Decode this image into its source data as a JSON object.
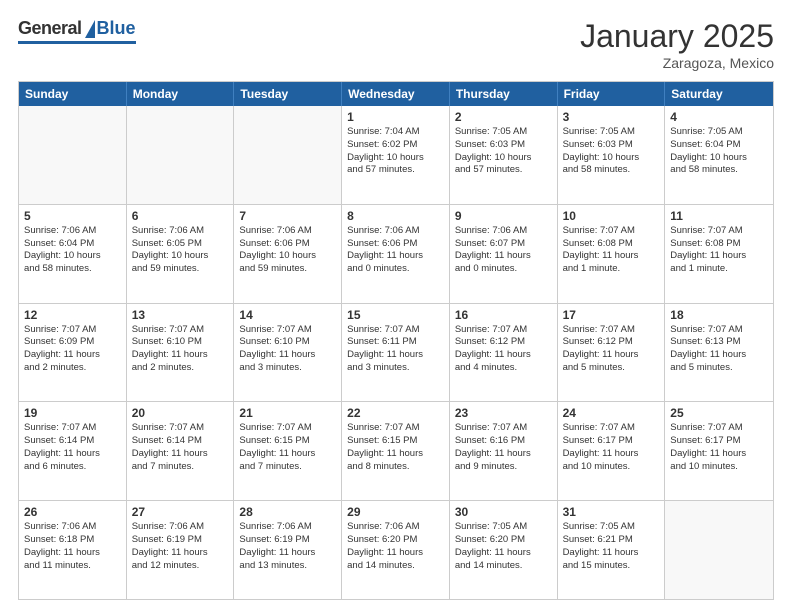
{
  "logo": {
    "general": "General",
    "blue": "Blue"
  },
  "header": {
    "month": "January 2025",
    "location": "Zaragoza, Mexico"
  },
  "days_of_week": [
    "Sunday",
    "Monday",
    "Tuesday",
    "Wednesday",
    "Thursday",
    "Friday",
    "Saturday"
  ],
  "weeks": [
    [
      {
        "day": "",
        "text": ""
      },
      {
        "day": "",
        "text": ""
      },
      {
        "day": "",
        "text": ""
      },
      {
        "day": "1",
        "text": "Sunrise: 7:04 AM\nSunset: 6:02 PM\nDaylight: 10 hours\nand 57 minutes."
      },
      {
        "day": "2",
        "text": "Sunrise: 7:05 AM\nSunset: 6:03 PM\nDaylight: 10 hours\nand 57 minutes."
      },
      {
        "day": "3",
        "text": "Sunrise: 7:05 AM\nSunset: 6:03 PM\nDaylight: 10 hours\nand 58 minutes."
      },
      {
        "day": "4",
        "text": "Sunrise: 7:05 AM\nSunset: 6:04 PM\nDaylight: 10 hours\nand 58 minutes."
      }
    ],
    [
      {
        "day": "5",
        "text": "Sunrise: 7:06 AM\nSunset: 6:04 PM\nDaylight: 10 hours\nand 58 minutes."
      },
      {
        "day": "6",
        "text": "Sunrise: 7:06 AM\nSunset: 6:05 PM\nDaylight: 10 hours\nand 59 minutes."
      },
      {
        "day": "7",
        "text": "Sunrise: 7:06 AM\nSunset: 6:06 PM\nDaylight: 10 hours\nand 59 minutes."
      },
      {
        "day": "8",
        "text": "Sunrise: 7:06 AM\nSunset: 6:06 PM\nDaylight: 11 hours\nand 0 minutes."
      },
      {
        "day": "9",
        "text": "Sunrise: 7:06 AM\nSunset: 6:07 PM\nDaylight: 11 hours\nand 0 minutes."
      },
      {
        "day": "10",
        "text": "Sunrise: 7:07 AM\nSunset: 6:08 PM\nDaylight: 11 hours\nand 1 minute."
      },
      {
        "day": "11",
        "text": "Sunrise: 7:07 AM\nSunset: 6:08 PM\nDaylight: 11 hours\nand 1 minute."
      }
    ],
    [
      {
        "day": "12",
        "text": "Sunrise: 7:07 AM\nSunset: 6:09 PM\nDaylight: 11 hours\nand 2 minutes."
      },
      {
        "day": "13",
        "text": "Sunrise: 7:07 AM\nSunset: 6:10 PM\nDaylight: 11 hours\nand 2 minutes."
      },
      {
        "day": "14",
        "text": "Sunrise: 7:07 AM\nSunset: 6:10 PM\nDaylight: 11 hours\nand 3 minutes."
      },
      {
        "day": "15",
        "text": "Sunrise: 7:07 AM\nSunset: 6:11 PM\nDaylight: 11 hours\nand 3 minutes."
      },
      {
        "day": "16",
        "text": "Sunrise: 7:07 AM\nSunset: 6:12 PM\nDaylight: 11 hours\nand 4 minutes."
      },
      {
        "day": "17",
        "text": "Sunrise: 7:07 AM\nSunset: 6:12 PM\nDaylight: 11 hours\nand 5 minutes."
      },
      {
        "day": "18",
        "text": "Sunrise: 7:07 AM\nSunset: 6:13 PM\nDaylight: 11 hours\nand 5 minutes."
      }
    ],
    [
      {
        "day": "19",
        "text": "Sunrise: 7:07 AM\nSunset: 6:14 PM\nDaylight: 11 hours\nand 6 minutes."
      },
      {
        "day": "20",
        "text": "Sunrise: 7:07 AM\nSunset: 6:14 PM\nDaylight: 11 hours\nand 7 minutes."
      },
      {
        "day": "21",
        "text": "Sunrise: 7:07 AM\nSunset: 6:15 PM\nDaylight: 11 hours\nand 7 minutes."
      },
      {
        "day": "22",
        "text": "Sunrise: 7:07 AM\nSunset: 6:15 PM\nDaylight: 11 hours\nand 8 minutes."
      },
      {
        "day": "23",
        "text": "Sunrise: 7:07 AM\nSunset: 6:16 PM\nDaylight: 11 hours\nand 9 minutes."
      },
      {
        "day": "24",
        "text": "Sunrise: 7:07 AM\nSunset: 6:17 PM\nDaylight: 11 hours\nand 10 minutes."
      },
      {
        "day": "25",
        "text": "Sunrise: 7:07 AM\nSunset: 6:17 PM\nDaylight: 11 hours\nand 10 minutes."
      }
    ],
    [
      {
        "day": "26",
        "text": "Sunrise: 7:06 AM\nSunset: 6:18 PM\nDaylight: 11 hours\nand 11 minutes."
      },
      {
        "day": "27",
        "text": "Sunrise: 7:06 AM\nSunset: 6:19 PM\nDaylight: 11 hours\nand 12 minutes."
      },
      {
        "day": "28",
        "text": "Sunrise: 7:06 AM\nSunset: 6:19 PM\nDaylight: 11 hours\nand 13 minutes."
      },
      {
        "day": "29",
        "text": "Sunrise: 7:06 AM\nSunset: 6:20 PM\nDaylight: 11 hours\nand 14 minutes."
      },
      {
        "day": "30",
        "text": "Sunrise: 7:05 AM\nSunset: 6:20 PM\nDaylight: 11 hours\nand 14 minutes."
      },
      {
        "day": "31",
        "text": "Sunrise: 7:05 AM\nSunset: 6:21 PM\nDaylight: 11 hours\nand 15 minutes."
      },
      {
        "day": "",
        "text": ""
      }
    ]
  ]
}
